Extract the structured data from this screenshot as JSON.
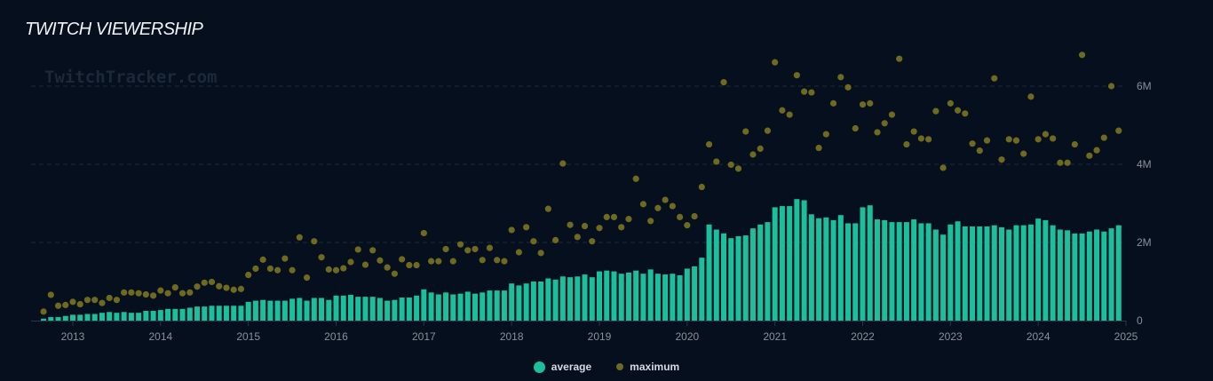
{
  "header": {
    "title": "TWITCH VIEWERSHIP",
    "watermark": "TwitchTracker.com"
  },
  "chart_data": {
    "type": "bar",
    "title": "TWITCH VIEWERSHIP",
    "xlabel": "",
    "ylabel": "",
    "x_start": "2012-09",
    "x_end": "2024-12",
    "frequency": "monthly",
    "x_ticks": [
      "2013",
      "2014",
      "2015",
      "2016",
      "2017",
      "2018",
      "2019",
      "2020",
      "2021",
      "2022",
      "2023",
      "2024",
      "2025"
    ],
    "y_ticks": [
      {
        "value": 0,
        "label": "0"
      },
      {
        "value": 2,
        "label": "2M"
      },
      {
        "value": 4,
        "label": "4M"
      },
      {
        "value": 6,
        "label": "6M"
      }
    ],
    "ylim": [
      0,
      7.0
    ],
    "units": "millions of viewers",
    "grid": true,
    "legend_position": "bottom-center",
    "colors": {
      "average": "#1bbf9c",
      "maximum": "#6e6a20",
      "background": "#050f1e"
    },
    "series": [
      {
        "name": "average",
        "type": "bar",
        "values": [
          0.05,
          0.09,
          0.09,
          0.12,
          0.15,
          0.15,
          0.17,
          0.17,
          0.2,
          0.22,
          0.2,
          0.22,
          0.2,
          0.2,
          0.25,
          0.25,
          0.27,
          0.3,
          0.3,
          0.3,
          0.33,
          0.36,
          0.36,
          0.38,
          0.38,
          0.38,
          0.38,
          0.38,
          0.48,
          0.51,
          0.53,
          0.51,
          0.51,
          0.51,
          0.56,
          0.58,
          0.51,
          0.58,
          0.58,
          0.53,
          0.64,
          0.64,
          0.66,
          0.61,
          0.61,
          0.61,
          0.58,
          0.51,
          0.53,
          0.59,
          0.59,
          0.64,
          0.8,
          0.72,
          0.67,
          0.72,
          0.67,
          0.69,
          0.74,
          0.69,
          0.72,
          0.77,
          0.77,
          0.77,
          0.95,
          0.9,
          0.95,
          1.0,
          1.0,
          1.08,
          1.05,
          1.13,
          1.11,
          1.13,
          1.18,
          1.11,
          1.26,
          1.28,
          1.26,
          1.2,
          1.23,
          1.28,
          1.2,
          1.31,
          1.2,
          1.18,
          1.2,
          1.16,
          1.33,
          1.39,
          1.61,
          2.46,
          2.33,
          2.23,
          2.11,
          2.16,
          2.18,
          2.36,
          2.46,
          2.52,
          2.9,
          2.93,
          2.93,
          3.11,
          3.08,
          2.72,
          2.62,
          2.64,
          2.57,
          2.7,
          2.49,
          2.49,
          2.9,
          2.95,
          2.59,
          2.57,
          2.52,
          2.52,
          2.52,
          2.59,
          2.49,
          2.49,
          2.33,
          2.2,
          2.46,
          2.54,
          2.41,
          2.41,
          2.41,
          2.41,
          2.44,
          2.39,
          2.33,
          2.44,
          2.44,
          2.46,
          2.61,
          2.57,
          2.44,
          2.33,
          2.31,
          2.23,
          2.23,
          2.28,
          2.33,
          2.28,
          2.36,
          2.44
        ]
      },
      {
        "name": "maximum",
        "type": "scatter",
        "values": [
          0.23,
          0.66,
          0.38,
          0.4,
          0.48,
          0.42,
          0.53,
          0.53,
          0.45,
          0.58,
          0.53,
          0.72,
          0.72,
          0.7,
          0.67,
          0.64,
          0.77,
          0.7,
          0.85,
          0.7,
          0.72,
          0.87,
          0.97,
          0.99,
          0.88,
          0.84,
          0.79,
          0.81,
          1.17,
          1.33,
          1.56,
          1.33,
          1.29,
          1.59,
          1.29,
          2.13,
          1.1,
          2.03,
          1.62,
          1.31,
          1.29,
          1.34,
          1.5,
          1.82,
          1.43,
          1.8,
          1.54,
          1.36,
          1.2,
          1.57,
          1.42,
          1.42,
          2.24,
          1.52,
          1.52,
          1.83,
          1.52,
          1.95,
          1.8,
          1.83,
          1.55,
          1.86,
          1.55,
          1.52,
          2.32,
          1.75,
          2.39,
          2.03,
          1.73,
          2.86,
          2.06,
          4.02,
          2.45,
          2.14,
          2.42,
          2.03,
          2.37,
          2.65,
          2.65,
          2.39,
          2.6,
          3.63,
          2.98,
          2.55,
          2.88,
          3.09,
          2.93,
          2.65,
          2.44,
          2.67,
          3.42,
          4.51,
          4.07,
          6.1,
          3.99,
          3.89,
          4.84,
          4.25,
          4.4,
          4.86,
          6.61,
          5.38,
          5.27,
          6.28,
          5.86,
          5.84,
          4.42,
          4.77,
          5.56,
          6.23,
          5.97,
          4.92,
          5.53,
          5.56,
          4.82,
          5.05,
          5.27,
          6.7,
          4.51,
          4.84,
          4.66,
          4.64,
          5.36,
          3.91,
          5.56,
          5.38,
          5.3,
          4.53,
          4.35,
          4.61,
          6.2,
          4.12,
          4.64,
          4.61,
          4.27,
          5.73,
          4.64,
          4.77,
          4.66,
          4.04,
          4.04,
          4.51,
          6.8,
          4.22,
          4.36,
          4.68,
          6.0,
          4.86
        ]
      }
    ]
  },
  "legend": {
    "average_label": "average",
    "maximum_label": "maximum"
  }
}
